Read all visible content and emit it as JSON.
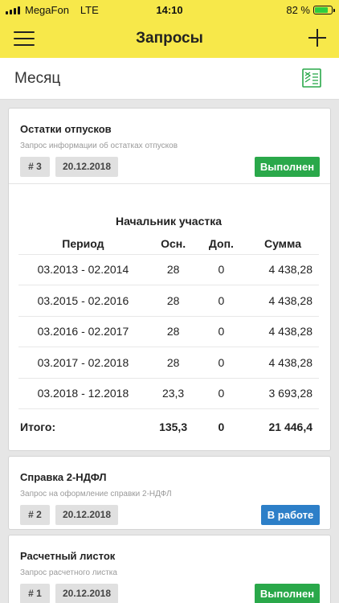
{
  "status_bar": {
    "carrier": "MegaFon",
    "network": "LTE",
    "time": "14:10",
    "battery_text": "82 %",
    "battery_level": 0.82
  },
  "header": {
    "title": "Запросы"
  },
  "period": {
    "label": "Месяц"
  },
  "cards": [
    {
      "title": "Остатки отпусков",
      "description": "Запрос информации об остатках отпусков",
      "number": "# 3",
      "date": "20.12.2018",
      "status": "Выполнен"
    },
    {
      "title": "Справка 2-НДФЛ",
      "description": "Запрос на оформление справки 2-НДФЛ",
      "number": "# 2",
      "date": "20.12.2018",
      "status": "В работе"
    },
    {
      "title": "Расчетный листок",
      "description": "Запрос расчетного листка",
      "number": "# 1",
      "date": "20.12.2018",
      "status": "Выполнен"
    }
  ],
  "detail": {
    "position": "Начальник участка",
    "columns": [
      "Период",
      "Осн.",
      "Доп.",
      "Сумма"
    ],
    "rows": [
      [
        "03.2013 - 02.2014",
        "28",
        "0",
        "4 438,28"
      ],
      [
        "03.2015 - 02.2016",
        "28",
        "0",
        "4 438,28"
      ],
      [
        "03.2016 - 02.2017",
        "28",
        "0",
        "4 438,28"
      ],
      [
        "03.2017 - 02.2018",
        "28",
        "0",
        "4 438,28"
      ],
      [
        "03.2018 - 12.2018",
        "23,3",
        "0",
        "3 693,28"
      ]
    ],
    "total": [
      "Итого:",
      "135,3",
      "0",
      "21 446,4"
    ]
  },
  "colors": {
    "header_bg": "#f7e84a",
    "status_done": "#2aa84a",
    "status_in_progress": "#2d7fc8"
  }
}
